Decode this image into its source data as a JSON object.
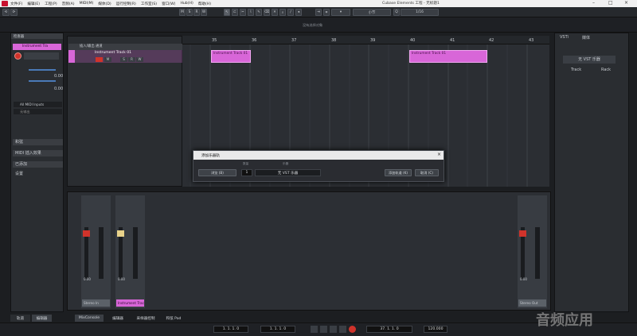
{
  "menubar": {
    "items": [
      "文件(F)",
      "编辑(E)",
      "工程(P)",
      "音频(A)",
      "MIDI(M)",
      "媒体(D)",
      "运行控制(R)",
      "工作室(S)",
      "窗口(W)",
      "Hub(H)",
      "帮助(H)"
    ],
    "app_title": "Cubase Elements 工程 - 无标题1"
  },
  "toolbar": {
    "mode_buttons": [
      "M",
      "S",
      "R",
      "W"
    ],
    "snap_value": "小节",
    "quantize_value": "1/16"
  },
  "status_message": "没有选择对象",
  "left_panel": {
    "tab_label": "检查器",
    "track_name": "Instrument Tra",
    "midi_input": "All MIDI Inputs",
    "routing_label": "无输出",
    "values": [
      "0.00",
      "0.00"
    ],
    "sections": [
      "和弦",
      "MIDI 插入效果",
      "已添加",
      "设置"
    ]
  },
  "track_list": {
    "header_label": "插入/输出 通道",
    "track_name": "Instrument Track 01",
    "buttons": [
      "M",
      "S",
      "R",
      "W"
    ]
  },
  "ruler": {
    "bars": [
      "35",
      "36",
      "37",
      "38",
      "39",
      "40",
      "41",
      "42",
      "43"
    ]
  },
  "clips": [
    {
      "label": "Instrument Track 01"
    },
    {
      "label": "Instrument Track 01"
    }
  ],
  "dialog": {
    "title": "添加乐器轨",
    "browse_label": "浏览 (B)",
    "count_caption": "数量",
    "count_value": "1",
    "instrument_caption": "乐器",
    "instrument_value": "无 VST 乐器",
    "add_label": "添加轨道 (K)",
    "cancel_label": "取消 (C)",
    "close_glyph": "×"
  },
  "mixer": {
    "strips": [
      {
        "name": "Stereo In",
        "value": "0.00",
        "color": "#9aa3ad"
      },
      {
        "name": "Instrument Trac",
        "value": "0.00",
        "color": "#d866d8"
      },
      {
        "name": "Stereo Out",
        "value": "0.00",
        "color": "#9aa3ad"
      }
    ]
  },
  "right_panel": {
    "tabs": [
      "VSTi",
      "媒体"
    ],
    "instrument_label": "无 VST 乐器",
    "track_label": "Track",
    "rack_label": "Rack"
  },
  "bottom_tabs": [
    "轨道",
    "编辑器",
    "MixConsole",
    "编辑器",
    "采样器控制",
    "和弦 Pad"
  ],
  "transport": {
    "left_locator": "1. 1. 1. 0",
    "right_locator": "1. 1. 1. 0",
    "position": "37. 1. 1. 0",
    "tempo": "120.000"
  },
  "watermark": "音频应用",
  "colors": {
    "accent": "#d866d8",
    "record": "#d0332b"
  }
}
